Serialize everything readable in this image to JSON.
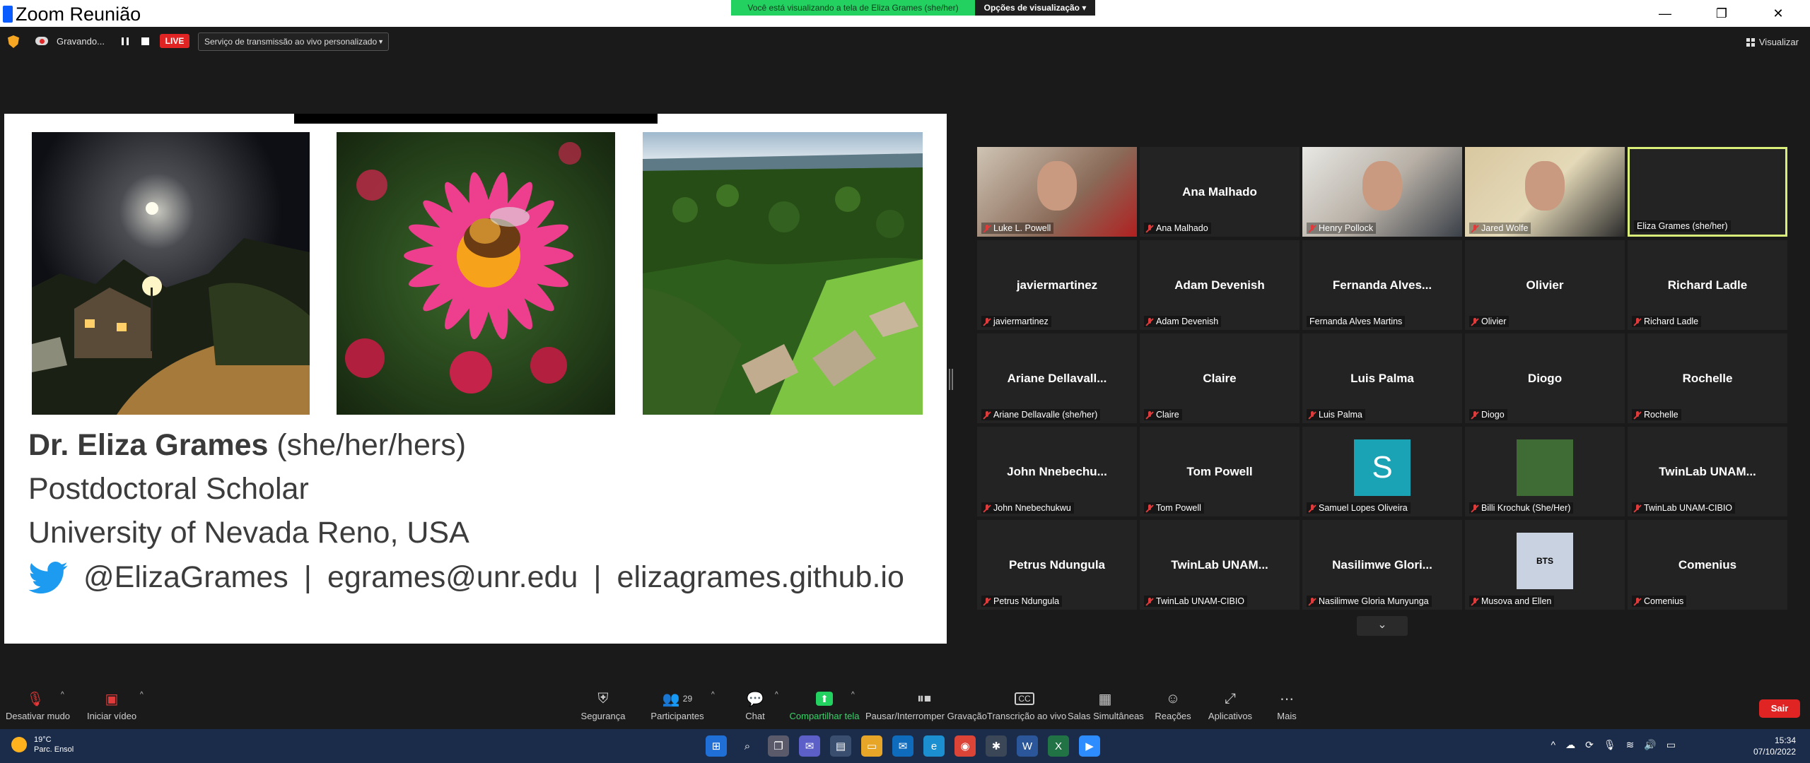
{
  "window": {
    "title": "Zoom Reunião",
    "share_banner": "Você está visualizando a tela de Eliza Grames (she/her)",
    "view_options": "Opções de visualização",
    "min": "—",
    "max": "❐",
    "close": "✕"
  },
  "recording": {
    "status": "Gravando...",
    "live": "LIVE",
    "stream_service": "Serviço de transmissão ao vivo personalizado",
    "view_label": "Visualizar"
  },
  "slide": {
    "name": "Dr. Eliza Grames",
    "pronouns": "(she/her/hers)",
    "position": "Postdoctoral Scholar",
    "institution": "University of Nevada Reno, USA",
    "twitter": "@ElizaGrames",
    "email": "egrames@unr.edu",
    "website": "elizagrames.github.io",
    "separator": "|"
  },
  "participants": [
    {
      "display": "",
      "label": "Luke L. Powell",
      "kind": "video"
    },
    {
      "display": "Ana Malhado",
      "label": "Ana Malhado",
      "kind": "name"
    },
    {
      "display": "",
      "label": "Henry Pollock",
      "kind": "video"
    },
    {
      "display": "",
      "label": "Jared Wolfe",
      "kind": "video"
    },
    {
      "display": "",
      "label": "Eliza Grames (she/her)",
      "kind": "active"
    },
    {
      "display": "javiermartinez",
      "label": "javiermartinez",
      "kind": "name"
    },
    {
      "display": "Adam Devenish",
      "label": "Adam Devenish",
      "kind": "name"
    },
    {
      "display": "Fernanda Alves...",
      "label": "Fernanda Alves Martins",
      "kind": "name"
    },
    {
      "display": "Olivier",
      "label": "Olivier",
      "kind": "name"
    },
    {
      "display": "Richard Ladle",
      "label": "Richard Ladle",
      "kind": "name"
    },
    {
      "display": "Ariane Dellavall...",
      "label": "Ariane Dellavalle (she/her)",
      "kind": "name"
    },
    {
      "display": "Claire",
      "label": "Claire",
      "kind": "name"
    },
    {
      "display": "Luis Palma",
      "label": "Luis Palma",
      "kind": "name"
    },
    {
      "display": "Diogo",
      "label": "Diogo",
      "kind": "name"
    },
    {
      "display": "Rochelle",
      "label": "Rochelle",
      "kind": "name"
    },
    {
      "display": "John Nnebechu...",
      "label": "John Nnebechukwu",
      "kind": "name"
    },
    {
      "display": "Tom Powell",
      "label": "Tom Powell",
      "kind": "name"
    },
    {
      "display": "S",
      "label": "Samuel Lopes Oliveira",
      "kind": "avatar-s"
    },
    {
      "display": "",
      "label": "Billi Krochuk (She/Her)",
      "kind": "avatar-photo"
    },
    {
      "display": "TwinLab UNAM...",
      "label": "TwinLab UNAM-CIBIO",
      "kind": "name"
    },
    {
      "display": "Petrus Ndungula",
      "label": "Petrus Ndungula",
      "kind": "name"
    },
    {
      "display": "TwinLab UNAM...",
      "label": "TwinLab UNAM-CIBIO",
      "kind": "name"
    },
    {
      "display": "Nasilimwe Glori...",
      "label": "Nasilimwe Gloria Munyunga",
      "kind": "name"
    },
    {
      "display": "BTS",
      "label": "Musova and Ellen",
      "kind": "avatar-bts"
    },
    {
      "display": "Comenius",
      "label": "Comenius",
      "kind": "name"
    }
  ],
  "toolbar": {
    "mute": "Desativar mudo",
    "video": "Iniciar vídeo",
    "security": "Segurança",
    "participants": "Participantes",
    "participants_count": "29",
    "chat": "Chat",
    "share": "Compartilhar tela",
    "pause_rec": "Pausar/Interromper Gravação",
    "transcription": "Transcrição ao vivo",
    "breakout": "Salas Simultâneas",
    "reactions": "Reações",
    "apps": "Aplicativos",
    "more": "Mais",
    "leave": "Sair"
  },
  "taskbar": {
    "temperature": "19°C",
    "weather": "Parc. Ensol",
    "time": "15:34",
    "date": "07/10/2022"
  },
  "colors": {
    "share_green": "#23d160",
    "live_red": "#e02424",
    "active_border": "#d9ef7a",
    "taskbar": "#1b2c4a"
  }
}
